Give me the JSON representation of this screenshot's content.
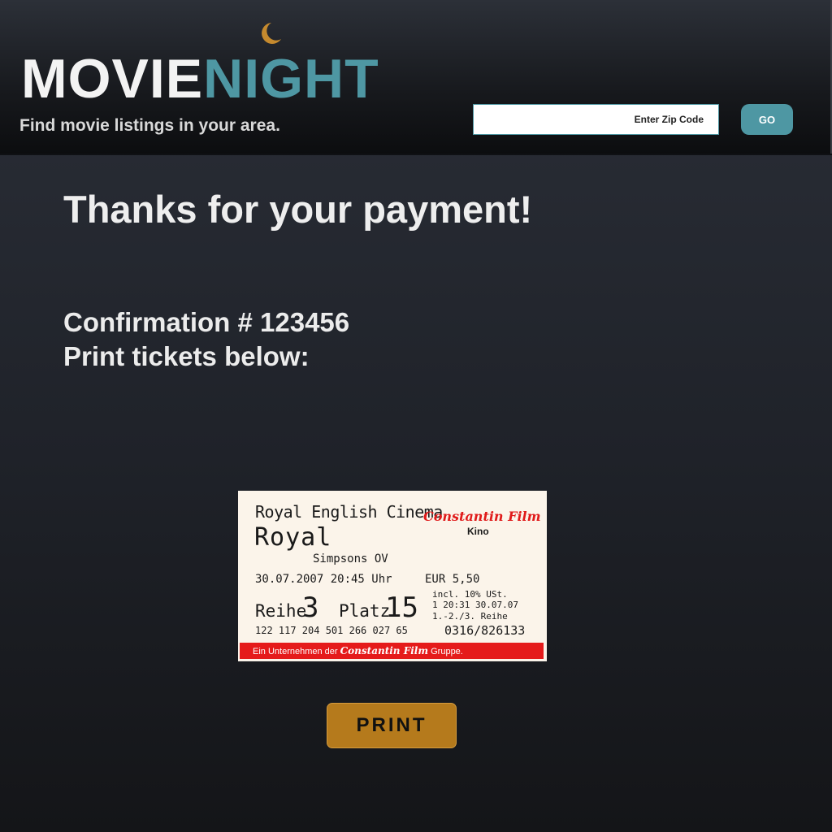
{
  "header": {
    "logo_part1": "MOVIE",
    "logo_part2": "NIGHT",
    "tagline": "Find movie listings in your area.",
    "zip_placeholder": "Enter Zip Code",
    "zip_value": "",
    "go_label": "GO",
    "moon_icon": "crescent-moon"
  },
  "main": {
    "heading": "Thanks for your payment!",
    "confirmation": "Confirmation # 123456",
    "print_instructions": "Print tickets below:",
    "print_label": "PRINT"
  },
  "ticket": {
    "cinema": "Royal English Cinema",
    "brand": "Constantin Film",
    "kino": "Kino",
    "hall": "Royal",
    "movie": "Simpsons OV",
    "datetime": "30.07.2007 20:45 Uhr",
    "price": "EUR 5,50",
    "row_label": "Reihe",
    "row": "3",
    "seat_label": "Platz",
    "seat": "15",
    "tax": "incl. 10% USt.",
    "issued": "1 20:31 30.07.07",
    "rows_range": "1.-2./3. Reihe",
    "barcode_digits": "122 117 204 501 266 027 65",
    "code": "0316/826133",
    "footer_prefix": "Ein Unternehmen der",
    "footer_brand": "Constantin Film",
    "footer_suffix": "Gruppe."
  },
  "colors": {
    "accent": "#4e97a3",
    "print_button": "#b57a1c",
    "ticket_red": "#e51b1b",
    "moon": "#c58a2e"
  }
}
